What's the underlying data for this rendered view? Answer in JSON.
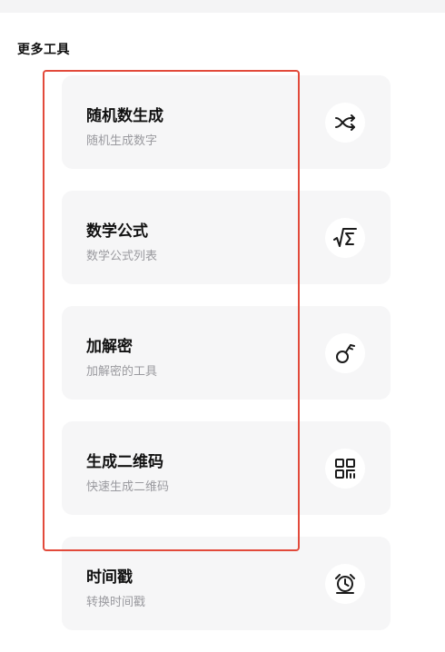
{
  "section": {
    "title": "更多工具"
  },
  "tools": [
    {
      "title": "随机数生成",
      "subtitle": "随机生成数字",
      "icon": "shuffle-icon"
    },
    {
      "title": "数学公式",
      "subtitle": "数学公式列表",
      "icon": "sqrt-sigma-icon"
    },
    {
      "title": "加解密",
      "subtitle": "加解密的工具",
      "icon": "key-icon"
    },
    {
      "title": "生成二维码",
      "subtitle": "快速生成二维码",
      "icon": "qr-code-icon"
    },
    {
      "title": "时间戳",
      "subtitle": "转换时间戳",
      "icon": "alarm-clock-icon"
    }
  ],
  "colors": {
    "highlight": "#e24a3b",
    "card_bg": "#f6f6f7",
    "subtitle": "#9a9a9f"
  }
}
